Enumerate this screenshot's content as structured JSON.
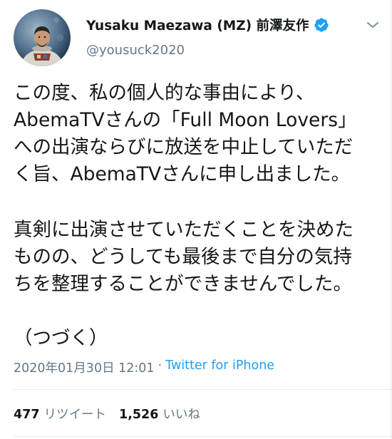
{
  "tweet": {
    "display_name": "Yusaku Maezawa (MZ) 前澤友作",
    "handle": "@yousuck2020",
    "verified": true,
    "text_lines": [
      "この度、私の個人的な事由により、",
      "AbemaTVさんの「Full Moon Lovers」",
      "への出演ならびに放送を中止していただ",
      "く旨、AbemaTVさんに申し出ました。",
      "",
      "真剣に出演させていただくことを決めた",
      "ものの、どうしても最後まで自分の気持",
      "ちを整理することができませんでした。",
      "",
      "（つづく）"
    ],
    "timestamp": "2020年01月30日 12:01",
    "separator": "·",
    "source": "Twitter for iPhone",
    "retweets_count": "477",
    "retweets_label": "リツイート",
    "likes_count": "1,526",
    "likes_label": "いいね"
  },
  "colors": {
    "text": "#14171a",
    "secondary": "#657786",
    "accent": "#1da1f2",
    "divider": "#e6ecf0"
  },
  "icons": {
    "verified": "verified-badge-icon",
    "caret": "chevron-down-icon"
  }
}
